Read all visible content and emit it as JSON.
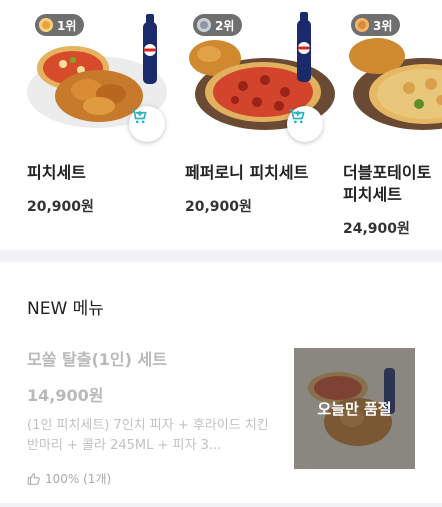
{
  "ranking": {
    "items": [
      {
        "rank": "1위",
        "name": "피치세트",
        "price": "20,900원",
        "image": "chicken-pizza-cola",
        "medal_color": "#e8a33d"
      },
      {
        "rank": "2위",
        "name": "페퍼로니 피치세트",
        "price": "20,900원",
        "image": "pepperoni-pizza-chicken-cola",
        "medal_color": "#9aa3ad"
      },
      {
        "rank": "3위",
        "name": "더블포테이토 피치세트",
        "price": "24,900원",
        "image": "potato-pizza-chicken",
        "medal_color": "#d98a3c"
      }
    ]
  },
  "new_menu": {
    "title": "NEW 메뉴",
    "items": [
      {
        "title": "모쏠 탈출(1인) 세트",
        "price": "14,900원",
        "description": "(1인 피치세트) 7인치 피자 + 후라이드 치킨 반마리 + 콜라 245ML + 피자 3...",
        "rating": "100% (1개)",
        "soldout_label": "오늘만 품절",
        "image": "pizza-chicken-cola"
      }
    ]
  },
  "icons": {
    "cart": "cart-plus-icon",
    "thumb": "thumbs-up-icon",
    "medal": "medal-icon"
  },
  "colors": {
    "cart_accent": "#2bb3c0",
    "muted_text": "#b9b9b9"
  }
}
